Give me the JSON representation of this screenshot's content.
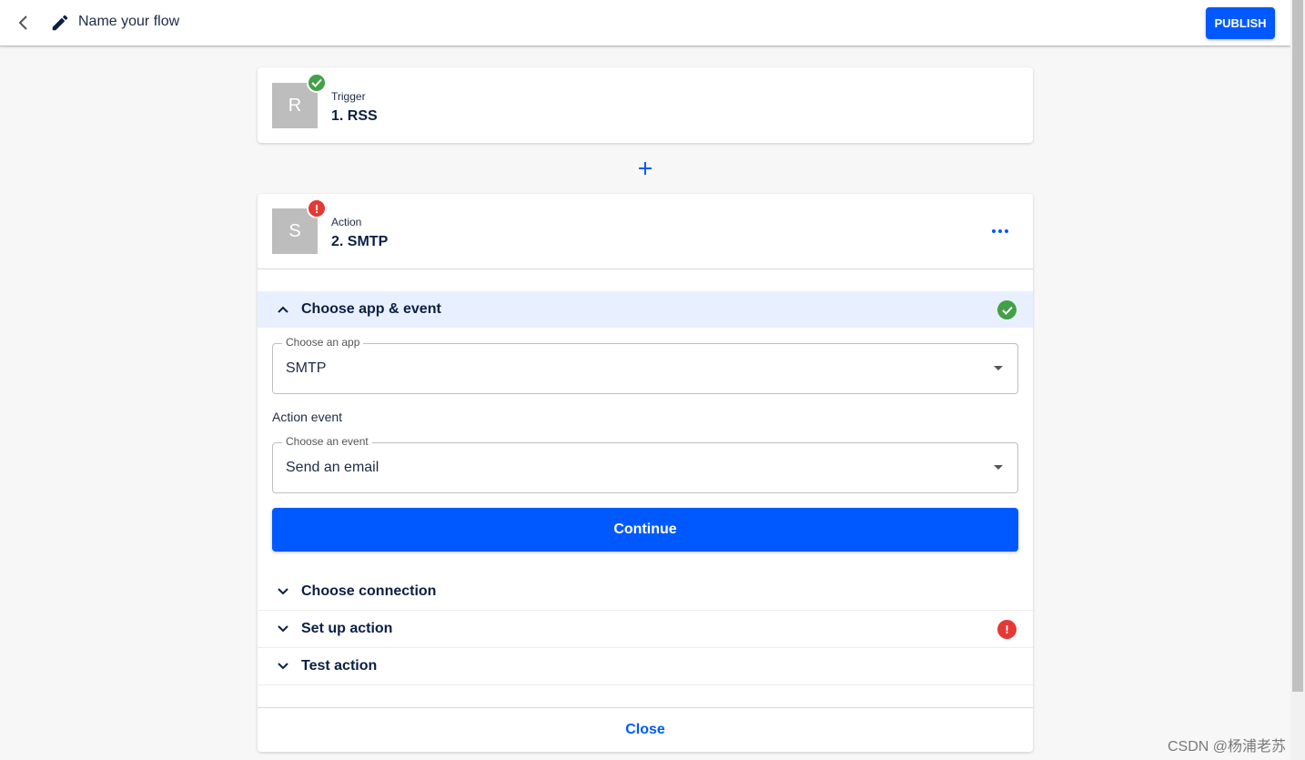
{
  "header": {
    "flow_name": "Name your flow",
    "publish_label": "PUBLISH"
  },
  "trigger": {
    "tile_letter": "R",
    "type_label": "Trigger",
    "title": "1. RSS"
  },
  "action": {
    "tile_letter": "S",
    "type_label": "Action",
    "title": "2. SMTP",
    "error_badge": "!",
    "sections": {
      "choose_app_event": "Choose app & event",
      "choose_connection": "Choose connection",
      "set_up_action": "Set up action",
      "test_action": "Test action"
    },
    "app_select": {
      "label": "Choose an app",
      "value": "SMTP"
    },
    "event_caption": "Action event",
    "event_select": {
      "label": "Choose an event",
      "value": "Send an email"
    },
    "continue_label": "Continue",
    "close_label": "Close",
    "section_error_badge": "!"
  },
  "watermark": "CSDN @杨浦老苏",
  "colors": {
    "accent": "#0059ff",
    "success": "#43a047",
    "error": "#e53935",
    "tile": "#bdbdbd",
    "active_section_bg": "#e8f0ff"
  }
}
